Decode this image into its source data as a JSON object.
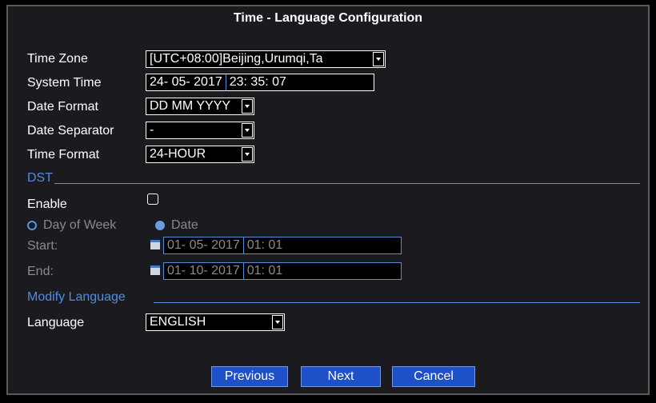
{
  "title": "Time - Language Configuration",
  "time_zone": {
    "label": "Time Zone",
    "value": "[UTC+08:00]Beijing,Urumqi,Ta"
  },
  "system_time": {
    "label": "System Time",
    "date": "24- 05- 2017",
    "time": "23: 35: 07"
  },
  "date_format": {
    "label": "Date Format",
    "value": "DD MM YYYY"
  },
  "date_separator": {
    "label": "Date Separator",
    "value": "-"
  },
  "time_format": {
    "label": "Time Format",
    "value": "24-HOUR"
  },
  "dst": {
    "section": "DST",
    "enable_label": "Enable",
    "enable_checked": false,
    "day_of_week_label": "Day of Week",
    "date_label": "Date",
    "selected_mode": "Date",
    "start_label": "Start:",
    "start_date": "01- 05- 2017",
    "start_time": "01: 01",
    "end_label": "End:",
    "end_date": "01- 10- 2017",
    "end_time": "01: 01"
  },
  "language_section": {
    "section": "Modify Language",
    "label": "Language",
    "value": "ENGLISH"
  },
  "buttons": {
    "previous": "Previous",
    "next": "Next",
    "cancel": "Cancel"
  },
  "colors": {
    "accent": "#4d8ce6",
    "button": "#1e50c8",
    "background": "#1b1b1f"
  }
}
